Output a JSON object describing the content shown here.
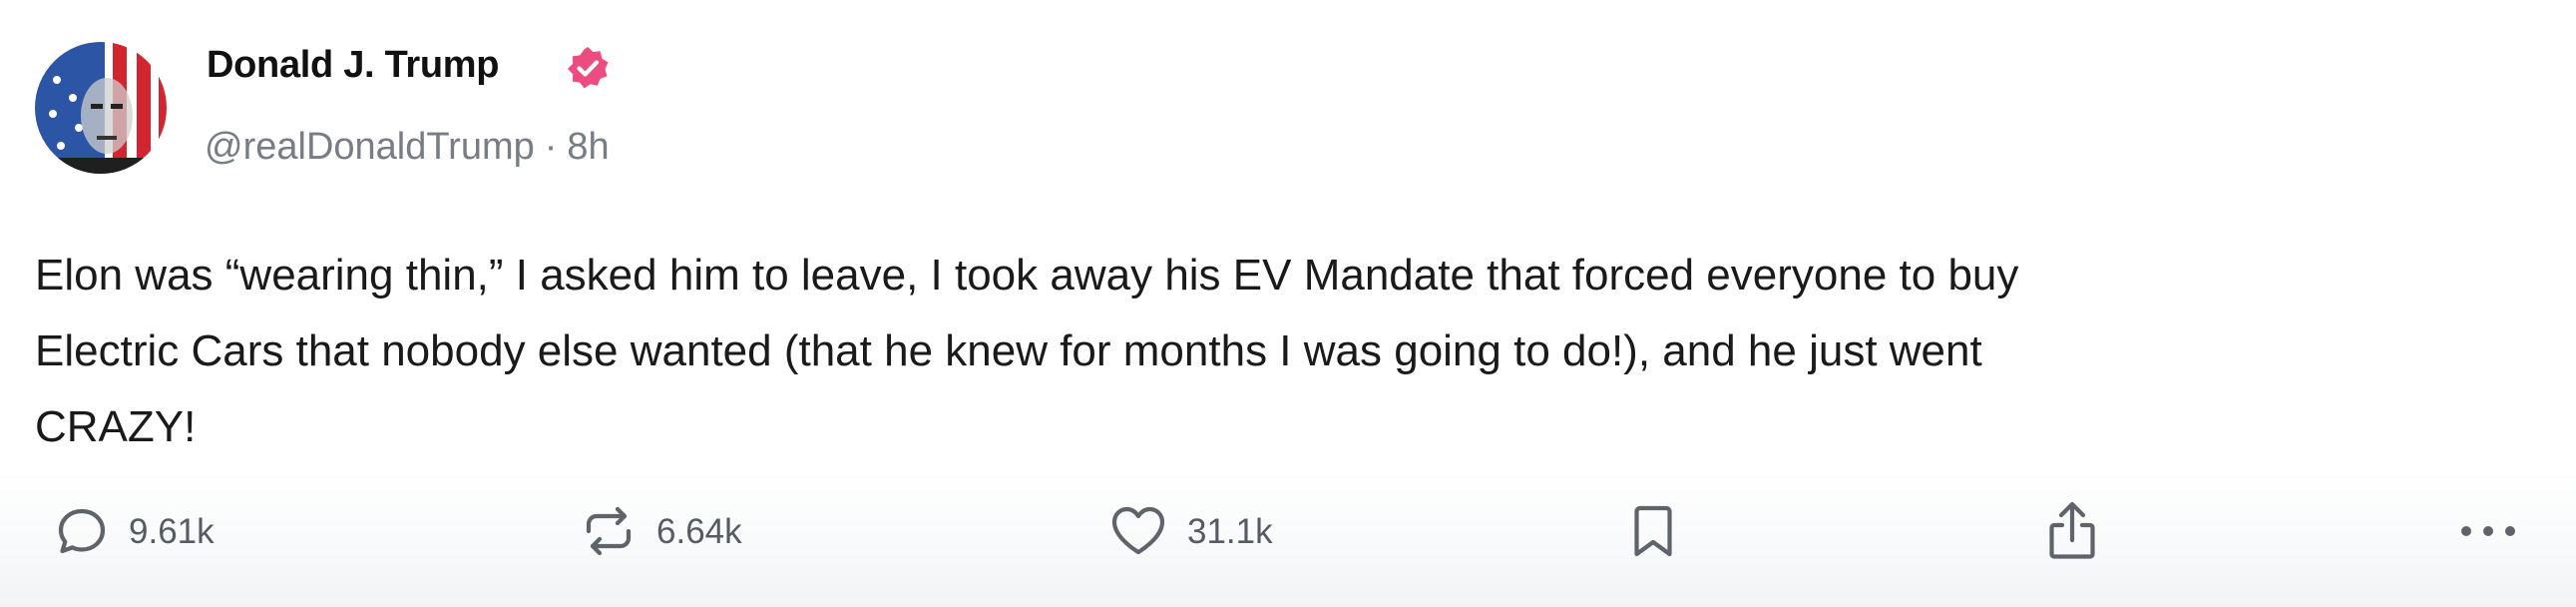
{
  "author": {
    "name": "Donald J. Trump",
    "handle": "@realDonaldTrump",
    "separator": "·",
    "time": "8h"
  },
  "post": {
    "text_lines": [
      "Elon was “wearing thin,” I asked him to leave, I took away his EV Mandate that forced everyone to buy",
      "Electric Cars that nobody else wanted (that he knew for months I was going to do!), and he just went",
      "CRAZY!"
    ]
  },
  "actions": {
    "replies": "9.61k",
    "reposts": "6.64k",
    "likes": "31.1k"
  },
  "colors": {
    "verified_badge": "#ec4c7f",
    "text": "#1a1a1a",
    "secondary_text": "#777c85",
    "icon": "#5f646b"
  },
  "icons": [
    "reply-icon",
    "repost-icon",
    "like-icon",
    "bookmark-icon",
    "share-icon",
    "more-icon",
    "verified-icon"
  ]
}
